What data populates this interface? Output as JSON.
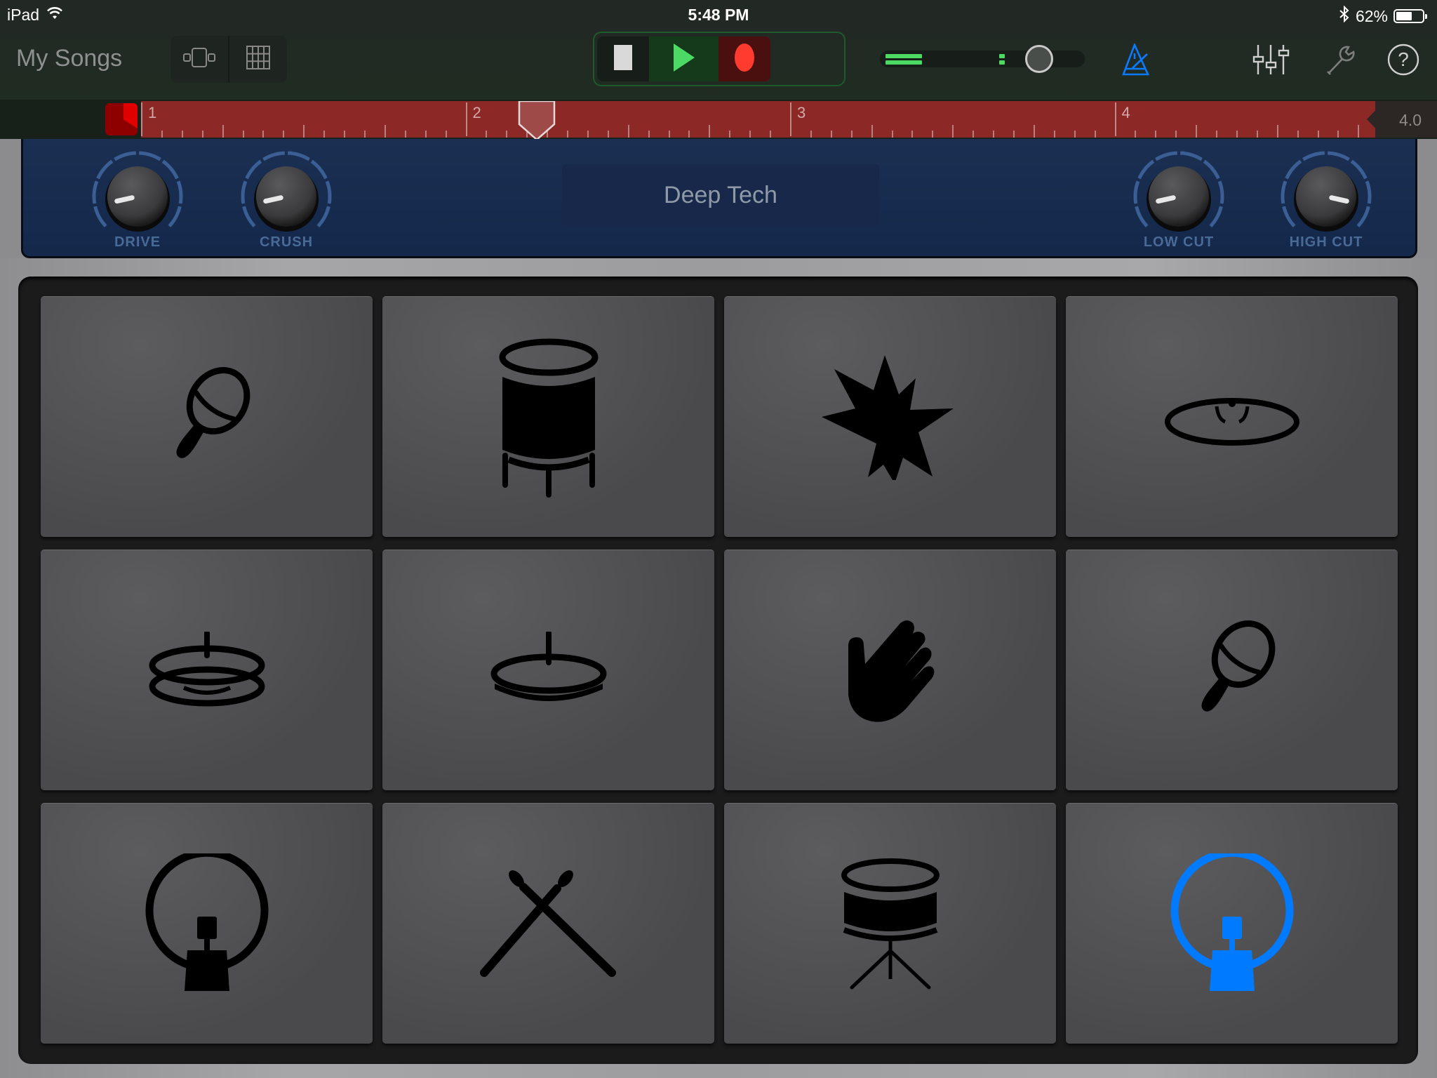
{
  "status_bar": {
    "device": "iPad",
    "wifi_icon": "wifi-icon",
    "time": "5:48 PM",
    "bluetooth_icon": "bluetooth-icon",
    "battery_percent": "62%",
    "battery_level": 0.62
  },
  "toolbar": {
    "my_songs_label": "My Songs",
    "view_toggle": [
      {
        "name": "tracks-view",
        "icon": "instrument-view-icon"
      },
      {
        "name": "grid-view",
        "icon": "grid-icon"
      }
    ],
    "transport": {
      "stop_icon": "stop-icon",
      "play_icon": "play-icon",
      "record_icon": "record-icon"
    },
    "master_volume": 0.82,
    "icons": [
      "metronome-icon",
      "mixer-icon",
      "wrench-icon",
      "help-icon"
    ],
    "colors": {
      "accent": "#007aff",
      "play": "#4cd964",
      "record": "#ff3b30",
      "meter": "#4cd964"
    }
  },
  "ruler": {
    "bars": [
      "1",
      "2",
      "3",
      "4"
    ],
    "end_label": "4.0",
    "playhead_position_bars": 2.22,
    "ruler_color": "#8c2927"
  },
  "effects": {
    "preset_name": "Deep Tech",
    "knobs": [
      {
        "label": "DRIVE",
        "value": 0.12
      },
      {
        "label": "CRUSH",
        "value": 0.12
      },
      {
        "label": "LOW CUT",
        "value": 0.12
      },
      {
        "label": "HIGH CUT",
        "value": 0.88
      }
    ]
  },
  "pads": [
    {
      "instrument": "maraca",
      "icon": "maraca-icon",
      "selected": false
    },
    {
      "instrument": "floor-tom",
      "icon": "floor-tom-icon",
      "selected": false
    },
    {
      "instrument": "effect-burst",
      "icon": "burst-icon",
      "selected": false
    },
    {
      "instrument": "crash-cymbal",
      "icon": "cymbal-icon",
      "selected": false
    },
    {
      "instrument": "open-hi-hat",
      "icon": "open-hi-hat-icon",
      "selected": false
    },
    {
      "instrument": "closed-hi-hat",
      "icon": "closed-hi-hat-icon",
      "selected": false
    },
    {
      "instrument": "clap",
      "icon": "hand-clap-icon",
      "selected": false
    },
    {
      "instrument": "shaker",
      "icon": "maraca-icon",
      "selected": false
    },
    {
      "instrument": "kick-drum",
      "icon": "kick-drum-icon",
      "selected": false
    },
    {
      "instrument": "rim-sticks",
      "icon": "drumsticks-icon",
      "selected": false
    },
    {
      "instrument": "snare-drum",
      "icon": "snare-drum-icon",
      "selected": false
    },
    {
      "instrument": "kick-drum-2",
      "icon": "kick-drum-icon",
      "selected": true
    }
  ]
}
